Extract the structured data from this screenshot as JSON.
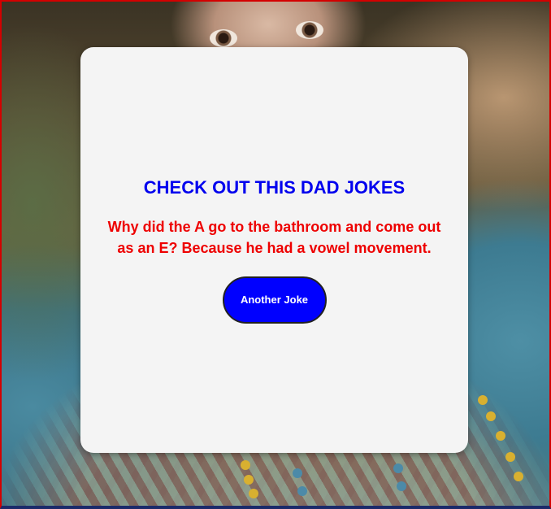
{
  "card": {
    "title": "CHECK OUT THIS DAD JOKES",
    "joke": "Why did the A go to the bathroom and come out as an E? Because he had a vowel movement.",
    "button_label": "Another Joke"
  },
  "colors": {
    "title": "#0000ee",
    "joke": "#ee0000",
    "button_bg": "#0000ff",
    "button_text": "#ffffff",
    "card_bg": "#f4f4f4",
    "frame": "#d40000"
  }
}
